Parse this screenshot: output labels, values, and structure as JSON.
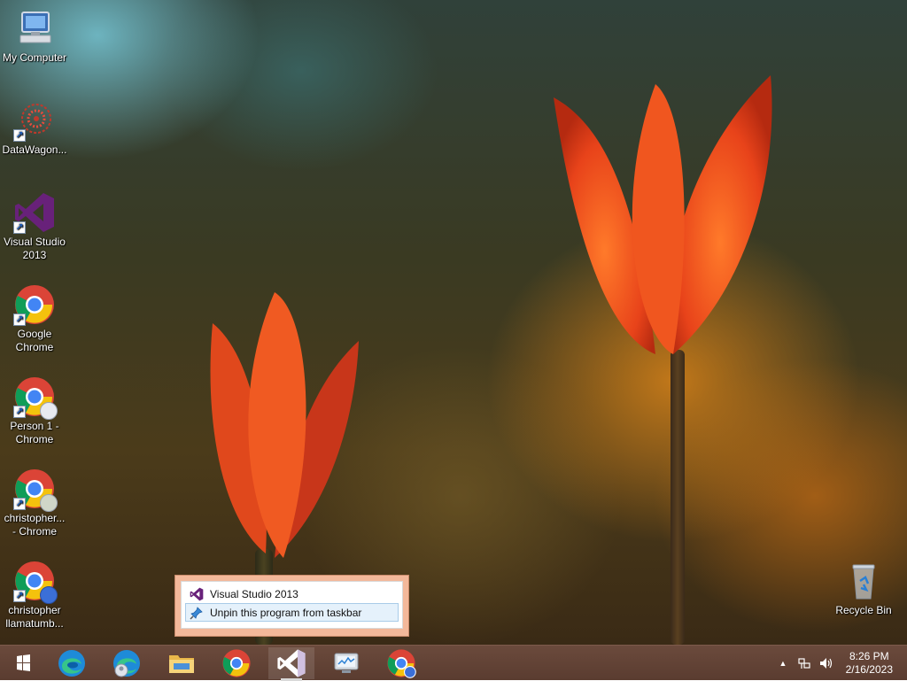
{
  "desktop": {
    "icons": [
      {
        "label": "My Computer",
        "icon": "my-computer-icon"
      },
      {
        "label": "DataWagon...",
        "icon": "datawagon-icon"
      },
      {
        "label": "Visual Studio 2013",
        "icon": "visual-studio-icon"
      },
      {
        "label": "Google Chrome",
        "icon": "chrome-icon"
      },
      {
        "label": "Person 1 - Chrome",
        "icon": "chrome-person-icon"
      },
      {
        "label": "christopher... - Chrome",
        "icon": "chrome-profile-icon"
      },
      {
        "label": "christopher llamatumb...",
        "icon": "chrome-profile-icon"
      },
      {
        "label": "Recycle Bin",
        "icon": "recycle-bin-icon"
      }
    ]
  },
  "jumplist": {
    "title": "Visual Studio 2013",
    "unpin_label": "Unpin this program from taskbar"
  },
  "taskbar": {
    "buttons": [
      {
        "name": "start-button",
        "icon": "windows-logo-icon"
      },
      {
        "name": "edge-button",
        "icon": "edge-icon"
      },
      {
        "name": "edge-profile-button",
        "icon": "edge-profile-icon"
      },
      {
        "name": "file-explorer-button",
        "icon": "folder-icon"
      },
      {
        "name": "chrome-button",
        "icon": "chrome-icon"
      },
      {
        "name": "visual-studio-button",
        "icon": "visual-studio-icon"
      },
      {
        "name": "resource-monitor-button",
        "icon": "monitor-icon"
      },
      {
        "name": "chrome-profile-button",
        "icon": "chrome-profile-icon"
      }
    ],
    "tray": {
      "show_hidden_label": "▲",
      "time": "8:26 PM",
      "date": "2/16/2023"
    }
  },
  "colors": {
    "taskbar": "#5a3c30",
    "jumplist_border": "#f3b89a",
    "hover_item": "#e5f1fb",
    "vs_purple": "#68217a"
  }
}
